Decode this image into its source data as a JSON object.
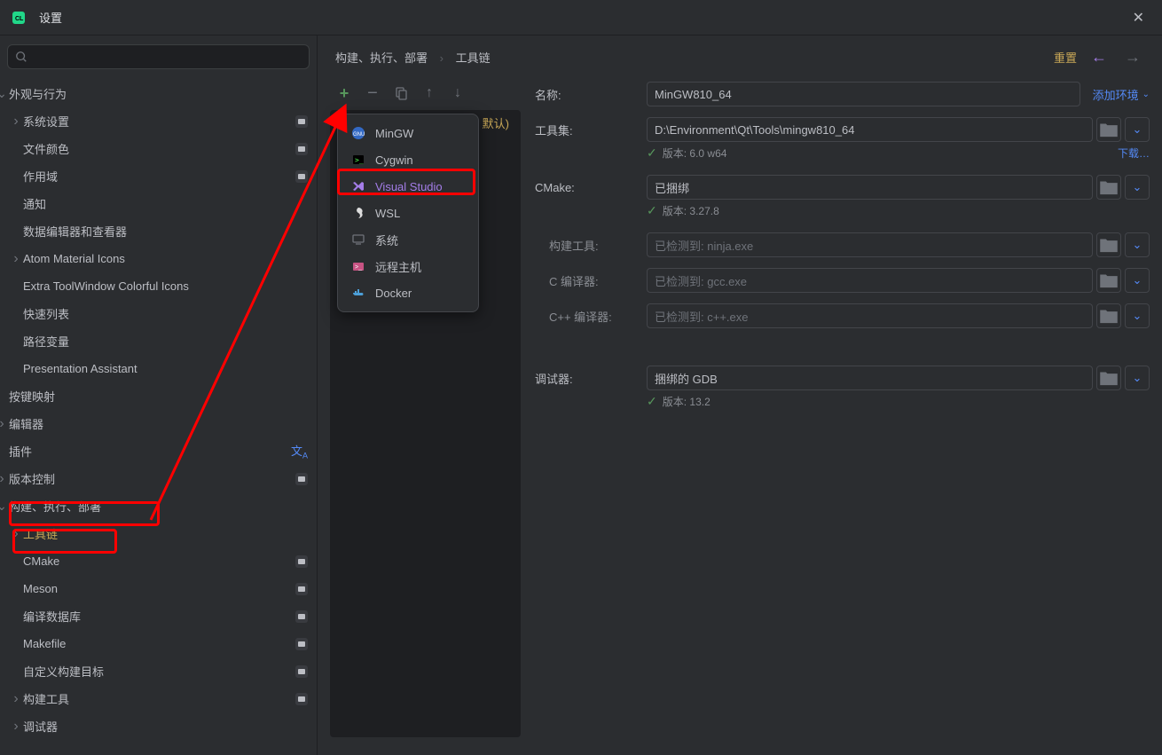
{
  "window": {
    "title": "设置"
  },
  "sidebar": {
    "tree": [
      {
        "label": "外观与行为",
        "level": 0,
        "chev": "down"
      },
      {
        "label": "系统设置",
        "level": 1,
        "chev": "right",
        "badge": true
      },
      {
        "label": "文件颜色",
        "level": 1,
        "badge": true
      },
      {
        "label": "作用域",
        "level": 1,
        "badge": true
      },
      {
        "label": "通知",
        "level": 1
      },
      {
        "label": "数据编辑器和查看器",
        "level": 1
      },
      {
        "label": "Atom Material Icons",
        "level": 1,
        "chev": "right"
      },
      {
        "label": "Extra ToolWindow Colorful Icons",
        "level": 1
      },
      {
        "label": "快速列表",
        "level": 1
      },
      {
        "label": "路径变量",
        "level": 1
      },
      {
        "label": "Presentation Assistant",
        "level": 1
      },
      {
        "label": "按键映射",
        "level": 0
      },
      {
        "label": "编辑器",
        "level": 0,
        "chev": "right"
      },
      {
        "label": "插件",
        "level": 0,
        "lang": true
      },
      {
        "label": "版本控制",
        "level": 0,
        "chev": "right",
        "badge": true
      },
      {
        "label": "构建、执行、部署",
        "level": 0,
        "chev": "down"
      },
      {
        "label": "工具链",
        "level": 1,
        "chev": "right",
        "selected": true
      },
      {
        "label": "CMake",
        "level": 1,
        "badge": true
      },
      {
        "label": "Meson",
        "level": 1,
        "badge": true
      },
      {
        "label": "编译数据库",
        "level": 1,
        "badge": true
      },
      {
        "label": "Makefile",
        "level": 1,
        "badge": true
      },
      {
        "label": "自定义构建目标",
        "level": 1,
        "badge": true
      },
      {
        "label": "构建工具",
        "level": 1,
        "chev": "right",
        "badge": true
      },
      {
        "label": "调试器",
        "level": 1,
        "chev": "right"
      }
    ]
  },
  "breadcrumb": {
    "part1": "构建、执行、部署",
    "part2": "工具链"
  },
  "header": {
    "reset": "重置"
  },
  "toolchain_list": {
    "default_suffix": "默认)"
  },
  "popup": {
    "items": [
      {
        "label": "MinGW",
        "icon": "mingw"
      },
      {
        "label": "Cygwin",
        "icon": "cygwin"
      },
      {
        "label": "Visual Studio",
        "icon": "vs",
        "selected": true
      },
      {
        "label": "WSL",
        "icon": "wsl"
      },
      {
        "label": "系统",
        "icon": "system"
      },
      {
        "label": "远程主机",
        "icon": "remote"
      },
      {
        "label": "Docker",
        "icon": "docker"
      }
    ]
  },
  "form": {
    "name": {
      "label": "名称:",
      "value": "MinGW810_64"
    },
    "add_env": "添加环境",
    "toolset": {
      "label": "工具集:",
      "value": "D:\\Environment\\Qt\\Tools\\mingw810_64",
      "version": "版本: 6.0 w64",
      "download": "下载…"
    },
    "cmake": {
      "label": "CMake:",
      "value": "已捆绑",
      "version": "版本: 3.27.8"
    },
    "buildtool": {
      "label": "构建工具:",
      "value": "已检测到: ninja.exe"
    },
    "c_compiler": {
      "label": "C 编译器:",
      "value": "已检测到: gcc.exe"
    },
    "cpp_compiler": {
      "label": "C++ 编译器:",
      "value": "已检测到: c++.exe"
    },
    "debugger": {
      "label": "调试器:",
      "value": "捆绑的 GDB",
      "version": "版本: 13.2"
    }
  }
}
